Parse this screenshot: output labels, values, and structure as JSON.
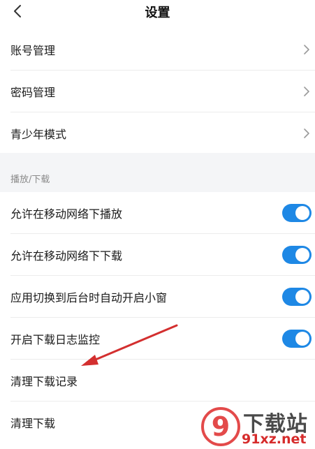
{
  "header": {
    "title": "设置",
    "back_icon": "chevron-left-icon"
  },
  "account_group": {
    "items": [
      {
        "label": "账号管理",
        "icon": "chevron-right-icon"
      },
      {
        "label": "密码管理",
        "icon": "chevron-right-icon"
      },
      {
        "label": "青少年模式",
        "icon": "chevron-right-icon"
      }
    ]
  },
  "playback_section": {
    "header": "播放/下载",
    "toggles": [
      {
        "label": "允许在移动网络下播放",
        "on": true
      },
      {
        "label": "允许在移动网络下下载",
        "on": true
      },
      {
        "label": "应用切换到后台时自动开启小窗",
        "on": true
      },
      {
        "label": "开启下载日志监控",
        "on": true
      }
    ],
    "actions": [
      {
        "label": "清理下载记录"
      },
      {
        "label": "清理下载"
      }
    ]
  },
  "colors": {
    "accent": "#1e88e5",
    "section_bg": "#f4f5f7",
    "annotation_arrow": "#d32f2f"
  },
  "watermark": {
    "text_big": "下载站",
    "text_small": "91xz.net",
    "badge": "9"
  }
}
